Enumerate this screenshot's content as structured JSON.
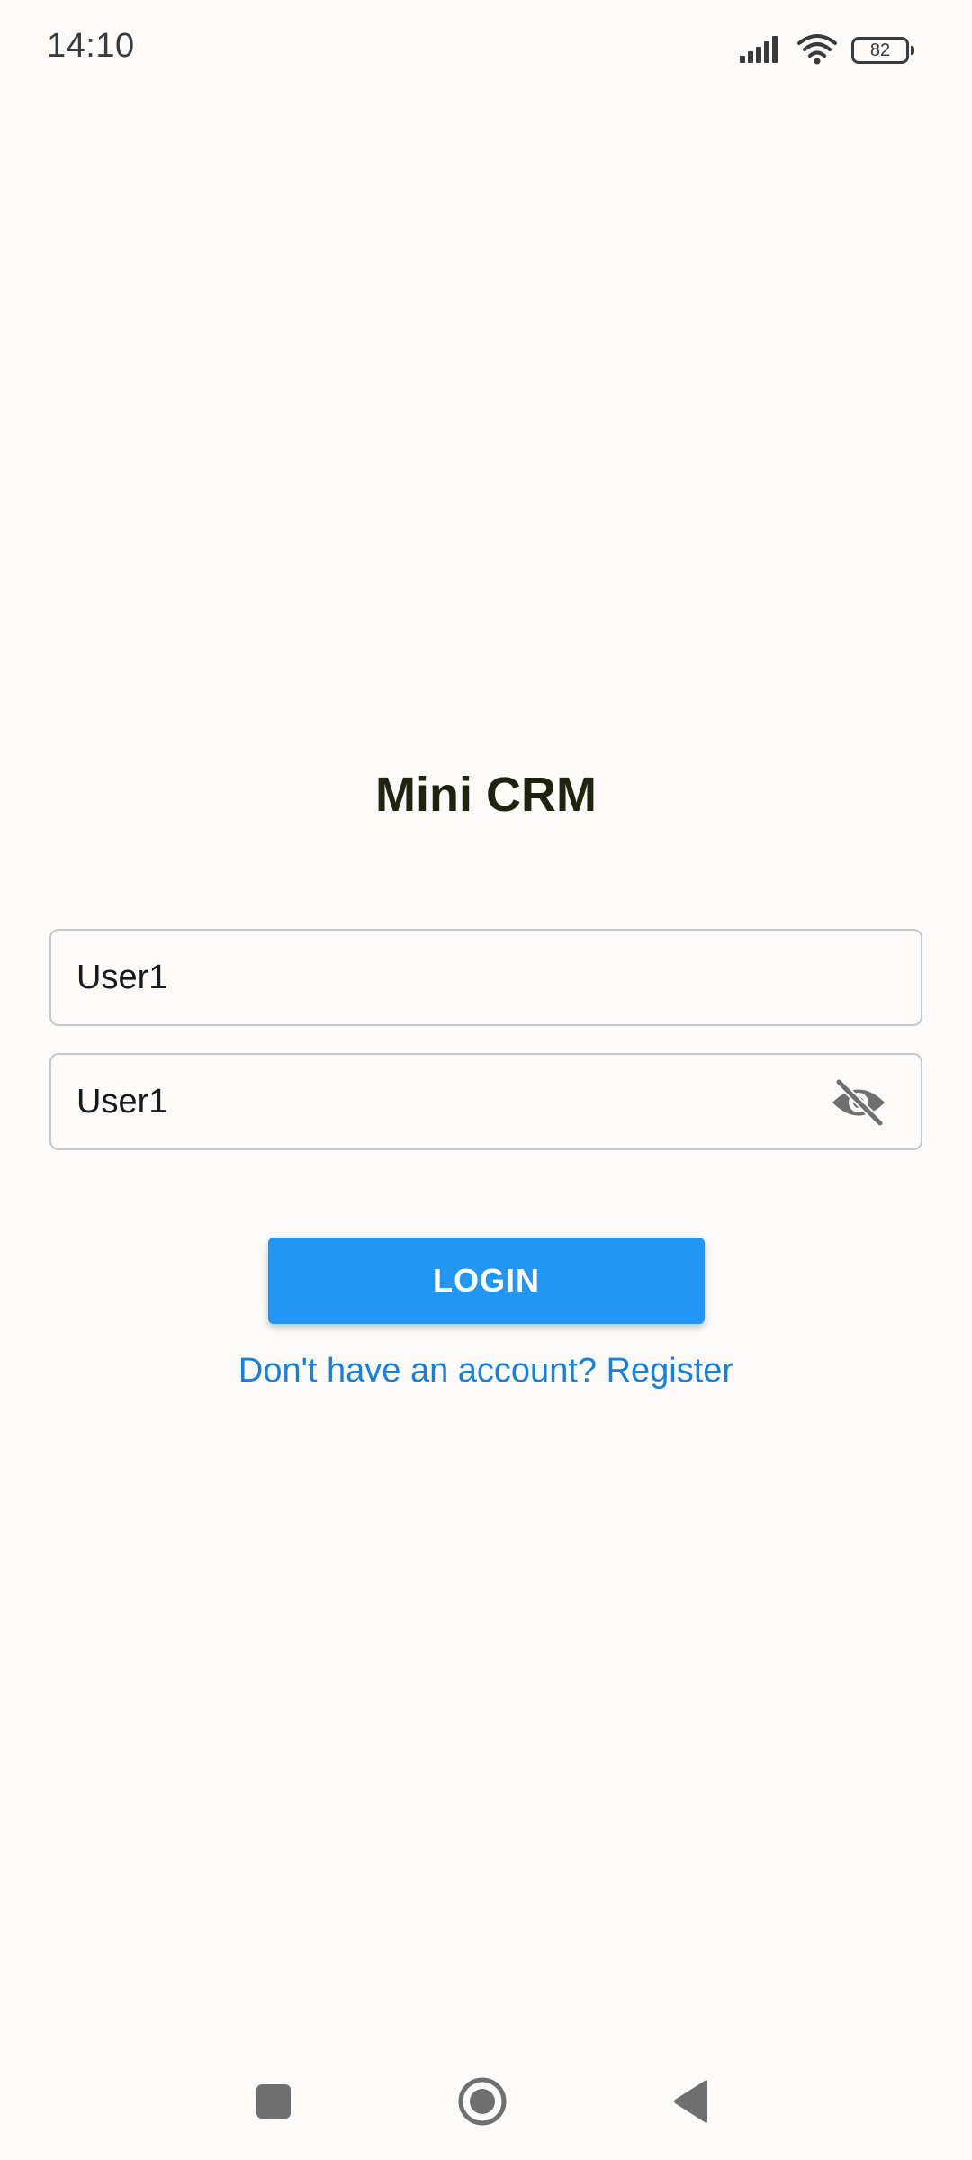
{
  "status_bar": {
    "time": "14:10",
    "battery": "82",
    "icons": [
      "signal-icon",
      "wifi-icon",
      "battery-icon"
    ]
  },
  "app": {
    "title": "Mini CRM"
  },
  "form": {
    "username_value": "User1",
    "password_value": "User1",
    "password_visibility_icon": "eye-off-icon",
    "login_label": "LOGIN",
    "register_label": "Don't have an account? Register"
  },
  "nav_bar": {
    "buttons": [
      "recents-icon",
      "home-icon",
      "back-icon"
    ]
  },
  "colors": {
    "background": "#fbfaf8",
    "primary": "#2396f3",
    "link": "#1a7fd6",
    "title": "#1e2410"
  }
}
